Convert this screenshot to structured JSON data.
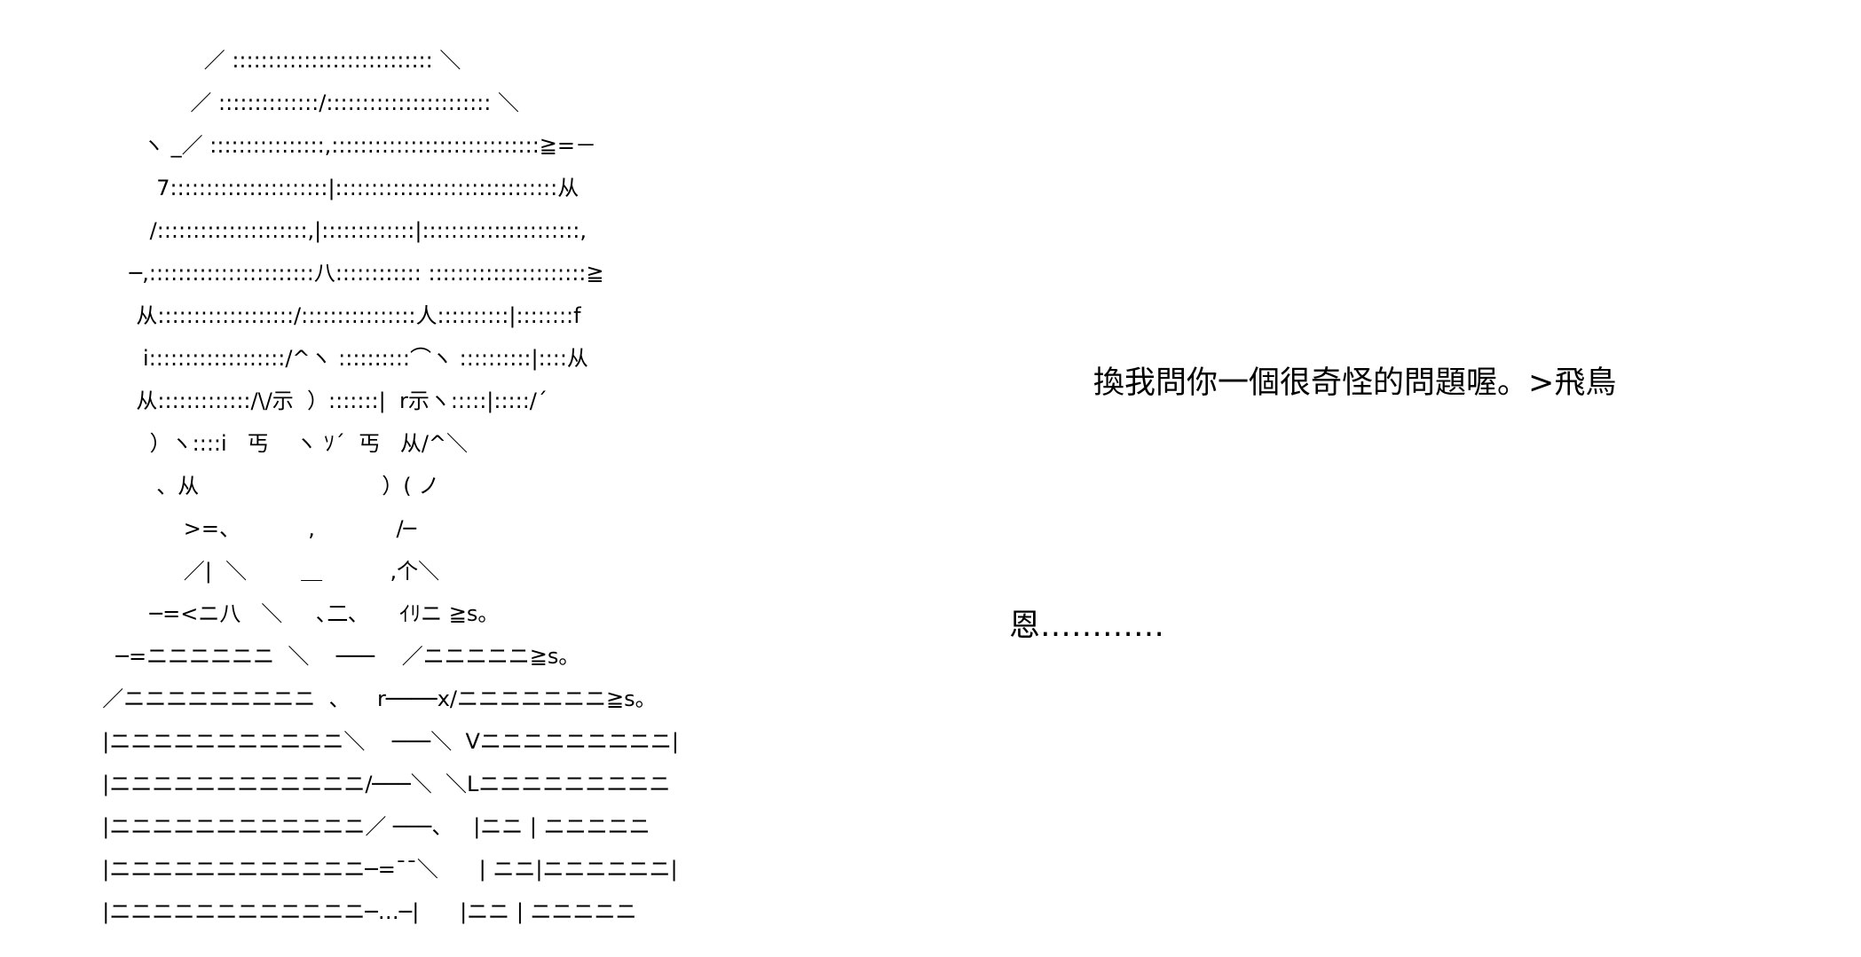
{
  "art_lines": [
    "                 ／ :::::::::::::::::::::::::::: ＼",
    "               ／ ::::::::::::::/::::::::::::::::::::::: ＼",
    "        ヽ _／ ::::::::::::::::,:::::::::::::::::::::::::::::≧=－",
    "          7::::::::::::::::::::::|:::::::::::::::::::::::::::::::从",
    "         /:::::::::::::::::::::,|:::::::::::::|::::::::::::::::::::::,",
    "      ─,:::::::::::::::::::::::八:::::::::::: ::::::::::::::::::::::≧",
    "       从:::::::::::::::::::/::::::::::::::::人::::::::::|::::::::f",
    "        i:::::::::::::::::::/^ヽ ::::::::::⌒ヽ ::::::::::|::::从",
    "       从:::::::::::::/\\/示  ）:::::::|  r示ヽ:::::|:::::/´",
    "         ）ヽ::::i   丐    ヽ ｿ´  丐   从/^＼",
    "          、从                           ）( ノ",
    "              >=、          ,            /─",
    "              ／|  ＼        ＿          ,个＼",
    "         ─=<ニ八   ＼     ､二､      ｲﾘニ ≧s。",
    "    ─=ニニニニニニ  ＼    ───    ／ニニニニニ≧s。",
    "  ／ニニニニニニニニニ  、    r────x/ニニニニニニニ≧s。",
    "  |ニニニニニニニニニニニ＼    ───＼  Vニニニニニニニニニ|",
    "  |ニニニニニニニニニニニニ/───＼  ＼Lニニニニニニニニニ",
    "  |ニニニニニニニニニニニニ／ ───、   |ニニ | ニニニニニ",
    "  |ニニニニニニニニニニニニ─=¯¯＼      | ニニ|ニニニニニニ|",
    "  |ニニニニニニニニニニニニ─…─|      |ニニ | ニニニニニ"
  ],
  "dialogue": {
    "line_1": "換我問你一個很奇怪的問題喔。>飛鳥",
    "line_2": "恩…………"
  }
}
